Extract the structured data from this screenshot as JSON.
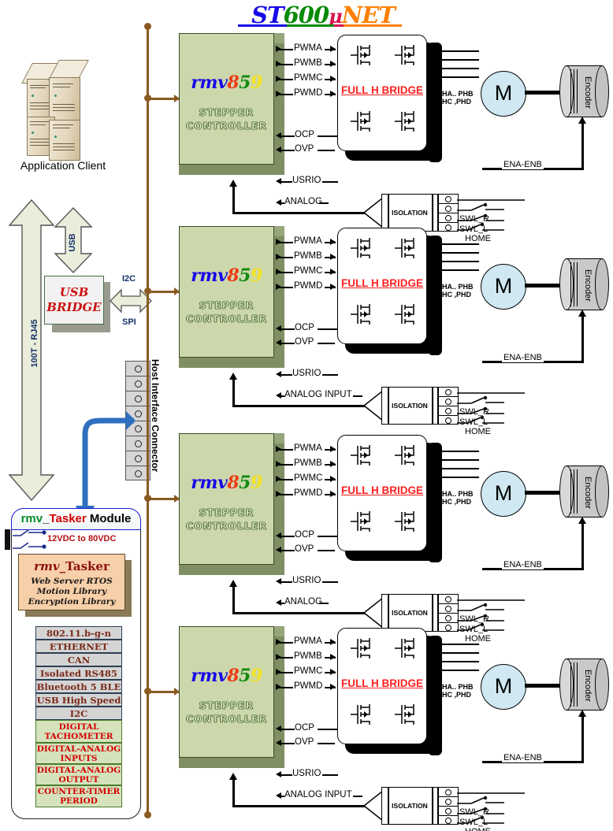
{
  "title": {
    "part_st": "ST",
    "part_600": "600",
    "part_mu": "μ",
    "part_net": "NET"
  },
  "left_panel": {
    "application_client_label": "Application Client",
    "ethernet_arrow_label": "100T - RJ45",
    "usb_arrow_label": "USB",
    "usb_bridge": {
      "line1": "USB",
      "line2": "BRIDGE"
    },
    "i2c_label": "I2C",
    "spi_label": "SPI",
    "host_interface_connector_label": "Host Interface Connector",
    "host_connector_pin_count": 8
  },
  "tasker": {
    "header": {
      "rmv": "rmv",
      "underscore": "_",
      "tasker": "Tasker",
      "module": " Module"
    },
    "voltage_label": "12VDC to 80VDC",
    "core": {
      "title_rmv": "rmv",
      "title_rest": "_Tasker",
      "lines": [
        "Web Server RTOS",
        "Motion Library",
        "Encryption Library"
      ]
    },
    "features": [
      "802.11.b-g-n",
      "ETHERNET",
      "CAN",
      "Isolated RS485",
      "Bluetooth 5 BLE",
      "USB High Speed",
      "I2C"
    ],
    "io_features": [
      "DIGITAL\nTACHOMETER",
      "DIGITAL-ANALOG\nINPUTS",
      "DIGITAL-ANALOG\nOUTPUT",
      "COUNTER-TIMER\nPERIOD"
    ]
  },
  "axes": [
    {
      "controller": {
        "logo_rmv": "rmv",
        "logo_8": "8",
        "logo_5": "5",
        "logo_9": "9",
        "sub_line1": "STEPPER",
        "sub_line2": "CONTROLLER"
      },
      "pwm_pins": [
        "PWMA",
        "PWMB",
        "PWMC",
        "PWMD"
      ],
      "fault_pins": [
        "OCP",
        "OVP"
      ],
      "usrio_pin": "USRIO",
      "analog_pin": "ANALOG",
      "bridge_label": "FULL H BRIDGE",
      "phase_label_line1": "PHA.. PHB",
      "phase_label_line2": "PHC ,PHD",
      "motor_label": "M",
      "encoder_label": "Encoder",
      "isolation_label": "ISOLATION",
      "ena_label": "ENA-ENB",
      "switch_labels": [
        "SWL_R",
        "SWL_L",
        "HOME"
      ]
    },
    {
      "controller": {
        "logo_rmv": "rmv",
        "logo_8": "8",
        "logo_5": "5",
        "logo_9": "9",
        "sub_line1": "STEPPER",
        "sub_line2": "CONTROLLER"
      },
      "pwm_pins": [
        "PWMA",
        "PWMB",
        "PWMC",
        "PWMD"
      ],
      "fault_pins": [
        "OCP",
        "OVP"
      ],
      "usrio_pin": "USRIO",
      "analog_pin": "ANALOG INPUT",
      "bridge_label": "FULL H BRIDGE",
      "phase_label_line1": "PHA.. PHB",
      "phase_label_line2": "PHC ,PHD",
      "motor_label": "M",
      "encoder_label": "Encoder",
      "isolation_label": "ISOLATION",
      "ena_label": "ENA-ENB",
      "switch_labels": [
        "SWL_R",
        "SWL_L",
        "HOME"
      ]
    },
    {
      "controller": {
        "logo_rmv": "rmv",
        "logo_8": "8",
        "logo_5": "5",
        "logo_9": "9",
        "sub_line1": "STEPPER",
        "sub_line2": "CONTROLLER"
      },
      "pwm_pins": [
        "PWMA",
        "PWMB",
        "PWMC",
        "PWMD"
      ],
      "fault_pins": [
        "OCP",
        "OVP"
      ],
      "usrio_pin": "USRIO",
      "analog_pin": "ANALOG",
      "bridge_label": "FULL H BRIDGE",
      "phase_label_line1": "PHA.. PHB",
      "phase_label_line2": "PHC ,PHD",
      "motor_label": "M",
      "encoder_label": "Encoder",
      "isolation_label": "ISOLATION",
      "ena_label": "ENA-ENB",
      "switch_labels": [
        "SWL_R",
        "SWL_L",
        "HOME"
      ]
    },
    {
      "controller": {
        "logo_rmv": "rmv",
        "logo_8": "8",
        "logo_5": "5",
        "logo_9": "9",
        "sub_line1": "STEPPER",
        "sub_line2": "CONTROLLER"
      },
      "pwm_pins": [
        "PWMA",
        "PWMB",
        "PWMC",
        "PWMD"
      ],
      "fault_pins": [
        "OCP",
        "OVP"
      ],
      "usrio_pin": "USRIO",
      "analog_pin": "ANALOG INPUT",
      "bridge_label": "FULL H BRIDGE",
      "phase_label_line1": "PHA.. PHB",
      "phase_label_line2": "PHC ,PHD",
      "motor_label": "M",
      "encoder_label": "Encoder",
      "isolation_label": "ISOLATION",
      "ena_label": "ENA-ENB",
      "switch_labels": [
        "SWL_R",
        "SWL_L",
        "HOME"
      ]
    }
  ],
  "colors": {
    "title_st": "#1808e8",
    "title_600": "#078a07",
    "title_mu": "#d4144a",
    "title_net": "#ff7f00",
    "bus": "#8a5a20",
    "controller_face": "#ccd8ab",
    "controller_side": "#7f8f63",
    "bridge_text": "#ff2020",
    "motor_fill": "#cfe8f2",
    "encoder_fill": "#c9c9c9",
    "tasker_core_fill": "#f7cfa8",
    "feature_fill": "#d4d4d4",
    "io_feature_fill": "#d5e3bc",
    "blue_arrow": "#2e6fc0"
  }
}
